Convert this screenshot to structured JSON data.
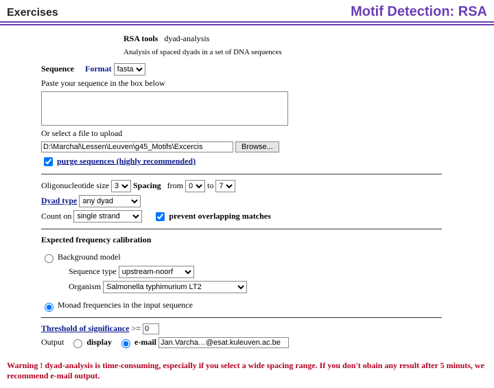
{
  "header": {
    "left": "Exercises",
    "right": "Motif Detection: RSA"
  },
  "tool": {
    "name_prefix": "RSA tools",
    "name_suffix": "dyad-analysis",
    "desc": "Analysis of spaced dyads in a set of DNA sequences"
  },
  "sequence": {
    "label": "Sequence",
    "format_label": "Format",
    "format_value": "fasta",
    "paste_hint": "Paste your sequence in the box below",
    "textarea_value": "",
    "or_upload": "Or select a file to upload",
    "file_path": "D:\\Marchal\\Lessen\\Leuven\\g45_Motifs\\Excercis",
    "browse": "Browse...",
    "purge_link": "purge sequences (highly recommended)"
  },
  "params": {
    "oligo_label": "Oligonucleotide size",
    "oligo_value": "3",
    "spacing_label": "Spacing",
    "from_label": "from",
    "from_value": "0",
    "to_label": "to",
    "to_value": "7",
    "dyad_type_label": "Dyad type",
    "dyad_type_value": "any dyad",
    "count_on_label": "Count on",
    "count_on_value": "single strand",
    "prevent_label": "prevent overlapping matches"
  },
  "calibration": {
    "heading": "Expected frequency calibration",
    "bg_label": "Background model",
    "seq_type_label": "Sequence type",
    "seq_type_value": "upstream-noorf",
    "organism_label": "Organism",
    "organism_value": "Salmonella typhimurium LT2",
    "monad_label": "Monad frequencies in the input sequence"
  },
  "output": {
    "threshold_label": "Threshold of significance",
    "threshold_op": ">=",
    "threshold_value": "0",
    "output_label": "Output",
    "display_label": "display",
    "email_label": "e-mail",
    "email_value": "Jan.Varcha…@esat.kuleuven.ac.be"
  },
  "warning": "Warning ! dyad-analysis is time-consuming, especially if you select a wide spacing range. If you don't obain any result after 5 minuts, we recommend e-mail output."
}
